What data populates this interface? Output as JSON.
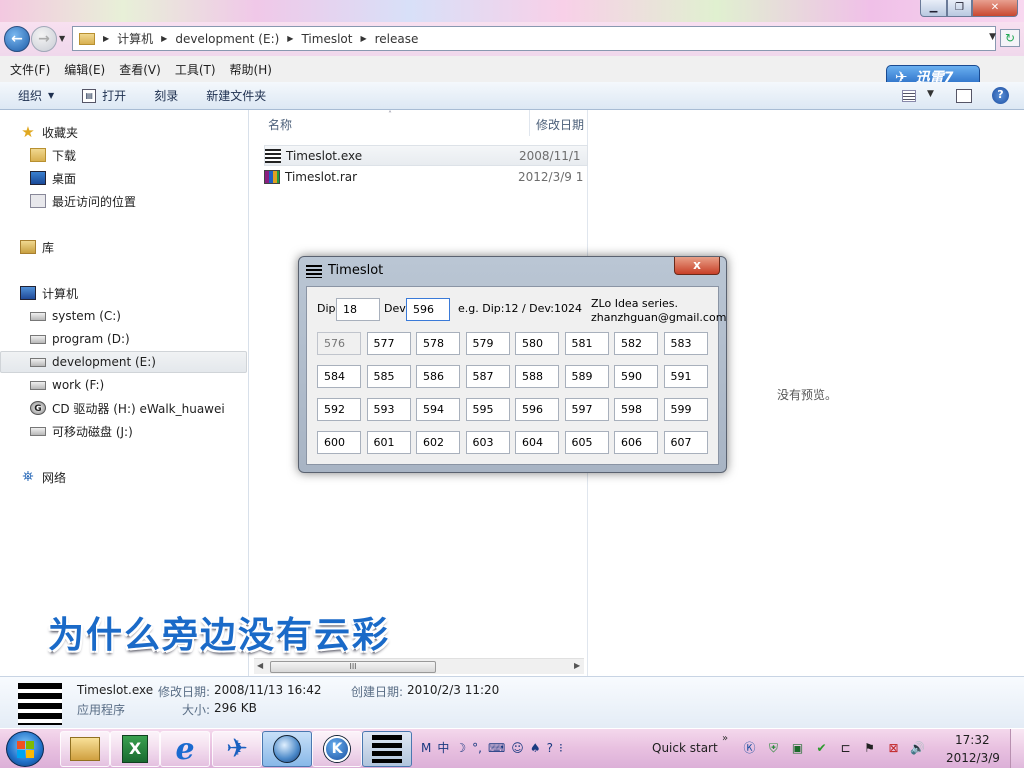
{
  "address": {
    "crumbs": [
      "计算机",
      "development (E:)",
      "Timeslot",
      "release"
    ]
  },
  "menu": [
    "文件(F)",
    "编辑(E)",
    "查看(V)",
    "工具(T)",
    "帮助(H)"
  ],
  "toolbar": {
    "organize": "组织",
    "open": "打开",
    "burn": "刻录",
    "new_folder": "新建文件夹"
  },
  "xunlei": {
    "label": "迅雷7"
  },
  "nav": {
    "favorites": "收藏夹",
    "downloads": "下载",
    "desktop": "桌面",
    "recent": "最近访问的位置",
    "library": "库",
    "computer": "计算机",
    "drives": [
      "system (C:)",
      "program (D:)",
      "development (E:)",
      "work (F:)",
      "CD 驱动器 (H:) eWalk_huawei",
      "可移动磁盘 (J:)"
    ],
    "cd_letter": "G",
    "network": "网络"
  },
  "filelist": {
    "col_name": "名称",
    "col_date": "修改日期",
    "files": [
      {
        "name": "Timeslot.exe",
        "date": "2008/11/1"
      },
      {
        "name": "Timeslot.rar",
        "date": "2012/3/9 1"
      }
    ],
    "scroll_grip": "III"
  },
  "preview": {
    "text": "没有预览。"
  },
  "caption": "为什么旁边没有云彩",
  "details": {
    "filename": "Timeslot.exe",
    "modified_label": "修改日期:",
    "modified_value": "2008/11/13 16:42",
    "created_label": "创建日期:",
    "created_value": "2010/2/3 11:20",
    "type": "应用程序",
    "size_label": "大小:",
    "size_value": "296 KB"
  },
  "dialog": {
    "title": "Timeslot",
    "close": "x",
    "dip_label": "Dip",
    "dip_value": "18",
    "dev_label": "Dev",
    "dev_value": "596",
    "example": "e.g. Dip:12 / Dev:1024",
    "credit_line1": "ZLo Idea series.",
    "credit_line2": "zhanzhguan@gmail.com",
    "cells": [
      "576",
      "577",
      "578",
      "579",
      "580",
      "581",
      "582",
      "583",
      "584",
      "585",
      "586",
      "587",
      "588",
      "589",
      "590",
      "591",
      "592",
      "593",
      "594",
      "595",
      "596",
      "597",
      "598",
      "599",
      "600",
      "601",
      "602",
      "603",
      "604",
      "605",
      "606",
      "607"
    ]
  },
  "taskbar": {
    "excel_glyph": "X",
    "ie_glyph": "e",
    "k_glyph": "K",
    "ime": [
      "M",
      "中",
      "☽",
      "°,",
      "⌨",
      "☺",
      "♠",
      "?",
      "⁝"
    ],
    "quick_start": "Quick start",
    "quick_chev": "»",
    "time": "17:32",
    "date": "2012/3/9"
  },
  "colors": {
    "caption_blue": "#1a6ac8",
    "accent": "#2064c0"
  }
}
